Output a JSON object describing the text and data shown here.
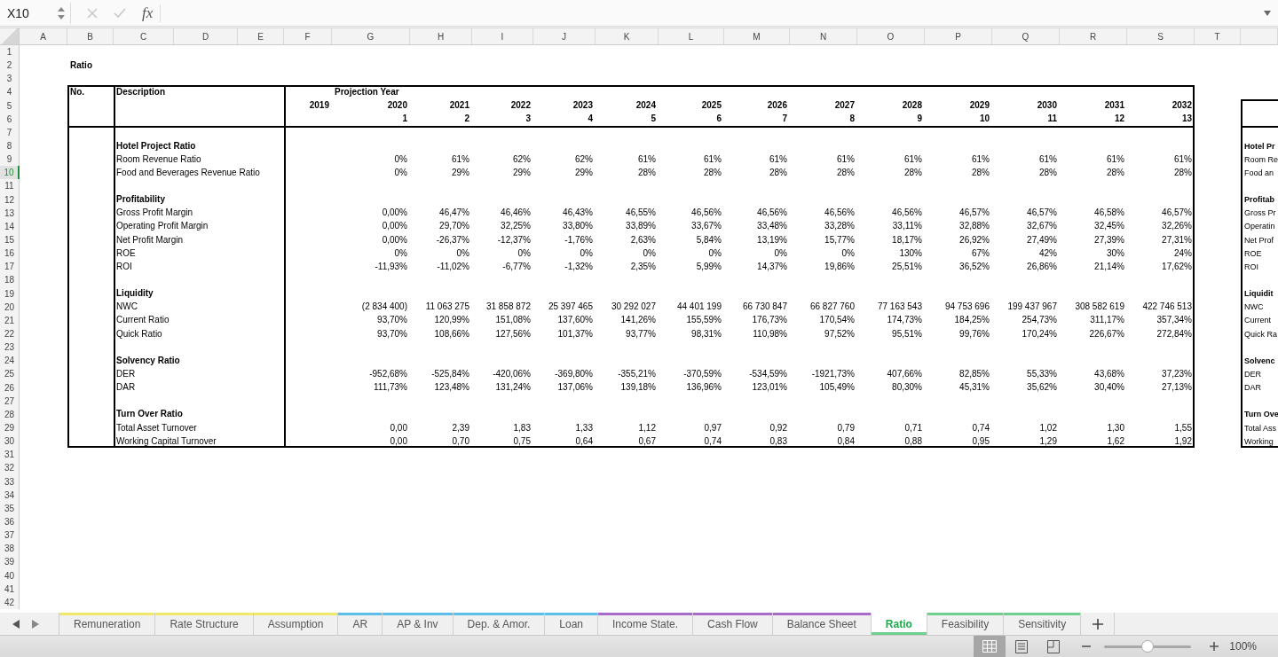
{
  "formula_bar": {
    "name_box": "X10",
    "function_label": "fx"
  },
  "columns": [
    "A",
    "B",
    "C",
    "D",
    "E",
    "F",
    "G",
    "H",
    "I",
    "J",
    "K",
    "L",
    "M",
    "N",
    "O",
    "P",
    "Q",
    "R",
    "S",
    "T"
  ],
  "rows": [
    {
      "label": "1",
      "selected": false
    },
    {
      "label": "2",
      "selected": false
    },
    {
      "label": "3",
      "selected": false
    },
    {
      "label": "4",
      "selected": false
    },
    {
      "label": "5",
      "selected": false
    },
    {
      "label": "6",
      "selected": false
    },
    {
      "label": "7",
      "selected": false
    },
    {
      "label": "8",
      "selected": false
    },
    {
      "label": "9",
      "selected": false
    },
    {
      "label": "10",
      "selected": true
    },
    {
      "label": "11",
      "selected": false
    },
    {
      "label": "12",
      "selected": false
    },
    {
      "label": "13",
      "selected": false
    },
    {
      "label": "14",
      "selected": false
    },
    {
      "label": "15",
      "selected": false
    },
    {
      "label": "16",
      "selected": false
    },
    {
      "label": "17",
      "selected": false
    },
    {
      "label": "18",
      "selected": false
    },
    {
      "label": "19",
      "selected": false
    },
    {
      "label": "20",
      "selected": false
    },
    {
      "label": "21",
      "selected": false
    },
    {
      "label": "22",
      "selected": false
    },
    {
      "label": "23",
      "selected": false
    },
    {
      "label": "24",
      "selected": false
    },
    {
      "label": "25",
      "selected": false
    },
    {
      "label": "26",
      "selected": false
    },
    {
      "label": "27",
      "selected": false
    },
    {
      "label": "28",
      "selected": false
    },
    {
      "label": "29",
      "selected": false
    },
    {
      "label": "30",
      "selected": false
    },
    {
      "label": "31",
      "selected": false
    },
    {
      "label": "32",
      "selected": false
    },
    {
      "label": "33",
      "selected": false
    },
    {
      "label": "34",
      "selected": false
    },
    {
      "label": "35",
      "selected": false
    },
    {
      "label": "36",
      "selected": false
    },
    {
      "label": "37",
      "selected": false
    },
    {
      "label": "38",
      "selected": false
    },
    {
      "label": "39",
      "selected": false
    },
    {
      "label": "40",
      "selected": false
    },
    {
      "label": "41",
      "selected": false
    },
    {
      "label": "42",
      "selected": false
    }
  ],
  "sheet": {
    "title": "Ratio",
    "table": {
      "no_header": "No.",
      "description_header": "Description",
      "projection_label": "Projection Year",
      "years": [
        {
          "year": "2019"
        },
        {
          "year": "2020",
          "index": "1"
        },
        {
          "year": "2021",
          "index": "2"
        },
        {
          "year": "2022",
          "index": "3"
        },
        {
          "year": "2023",
          "index": "4"
        },
        {
          "year": "2024",
          "index": "5"
        },
        {
          "year": "2025",
          "index": "6"
        },
        {
          "year": "2026",
          "index": "7"
        },
        {
          "year": "2027",
          "index": "8"
        },
        {
          "year": "2028",
          "index": "9"
        },
        {
          "year": "2029",
          "index": "10"
        },
        {
          "year": "2030",
          "index": "11"
        },
        {
          "year": "2031",
          "index": "12"
        },
        {
          "year": "2032",
          "index": "13"
        }
      ],
      "sections": [
        {
          "title": "Hotel Project Ratio",
          "rows": [
            {
              "label": "Room Revenue Ratio",
              "values": [
                "0%",
                "61%",
                "62%",
                "62%",
                "61%",
                "61%",
                "61%",
                "61%",
                "61%",
                "61%",
                "61%",
                "61%",
                "61%"
              ]
            },
            {
              "label": "Food and Beverages Revenue Ratio",
              "values": [
                "0%",
                "29%",
                "29%",
                "29%",
                "28%",
                "28%",
                "28%",
                "28%",
                "28%",
                "28%",
                "28%",
                "28%",
                "28%"
              ]
            }
          ]
        },
        {
          "title": "Profitability",
          "rows": [
            {
              "label": "Gross Profit Margin",
              "values": [
                "0,00%",
                "46,47%",
                "46,46%",
                "46,43%",
                "46,55%",
                "46,56%",
                "46,56%",
                "46,56%",
                "46,56%",
                "46,57%",
                "46,57%",
                "46,58%",
                "46,57%"
              ]
            },
            {
              "label": "Operating Profit Margin",
              "values": [
                "0,00%",
                "29,70%",
                "32,25%",
                "33,80%",
                "33,89%",
                "33,67%",
                "33,48%",
                "33,28%",
                "33,11%",
                "32,88%",
                "32,67%",
                "32,45%",
                "32,26%"
              ]
            },
            {
              "label": "Net Profit Margin",
              "values": [
                "0,00%",
                "-26,37%",
                "-12,37%",
                "-1,76%",
                "2,63%",
                "5,84%",
                "13,19%",
                "15,77%",
                "18,17%",
                "26,92%",
                "27,49%",
                "27,39%",
                "27,31%"
              ]
            },
            {
              "label": "ROE",
              "values": [
                "0%",
                "0%",
                "0%",
                "0%",
                "0%",
                "0%",
                "0%",
                "0%",
                "130%",
                "67%",
                "42%",
                "30%",
                "24%"
              ]
            },
            {
              "label": "ROI",
              "values": [
                "-11,93%",
                "-11,02%",
                "-6,77%",
                "-1,32%",
                "2,35%",
                "5,99%",
                "14,37%",
                "19,86%",
                "25,51%",
                "36,52%",
                "26,86%",
                "21,14%",
                "17,62%"
              ]
            }
          ]
        },
        {
          "title": "Liquidity",
          "rows": [
            {
              "label": "NWC",
              "values": [
                "(2 834 400)",
                "11 063 275",
                "31 858 872",
                "25 397 465",
                "30 292 027",
                "44 401 199",
                "66 730 847",
                "66 827 760",
                "77 163 543",
                "94 753 696",
                "199 437 967",
                "308 582 619",
                "422 746 513"
              ]
            },
            {
              "label": "Current Ratio",
              "values": [
                "93,70%",
                "120,99%",
                "151,08%",
                "137,60%",
                "141,26%",
                "155,59%",
                "176,73%",
                "170,54%",
                "174,73%",
                "184,25%",
                "254,73%",
                "311,17%",
                "357,34%"
              ]
            },
            {
              "label": "Quick Ratio",
              "values": [
                "93,70%",
                "108,66%",
                "127,56%",
                "101,37%",
                "93,77%",
                "98,31%",
                "110,98%",
                "97,52%",
                "95,51%",
                "99,76%",
                "170,24%",
                "226,67%",
                "272,84%"
              ]
            }
          ]
        },
        {
          "title": "Solvency Ratio",
          "rows": [
            {
              "label": "DER",
              "values": [
                "-952,68%",
                "-525,84%",
                "-420,06%",
                "-369,80%",
                "-355,21%",
                "-370,59%",
                "-534,59%",
                "-1921,73%",
                "407,66%",
                "82,85%",
                "55,33%",
                "43,68%",
                "37,23%"
              ]
            },
            {
              "label": "DAR",
              "values": [
                "111,73%",
                "123,48%",
                "131,24%",
                "137,06%",
                "139,18%",
                "136,96%",
                "123,01%",
                "105,49%",
                "80,30%",
                "45,31%",
                "35,62%",
                "30,40%",
                "27,13%"
              ]
            }
          ]
        },
        {
          "title": "Turn Over Ratio",
          "rows": [
            {
              "label": "Total Asset Turnover",
              "values": [
                "0,00",
                "2,39",
                "1,83",
                "1,33",
                "1,12",
                "0,97",
                "0,92",
                "0,79",
                "0,71",
                "0,74",
                "1,02",
                "1,30",
                "1,55"
              ]
            },
            {
              "label": "Working Capital Turnover",
              "values": [
                "0,00",
                "0,70",
                "0,75",
                "0,64",
                "0,67",
                "0,74",
                "0,83",
                "0,84",
                "0,88",
                "0,95",
                "1,29",
                "1,62",
                "1,92"
              ]
            }
          ]
        }
      ]
    },
    "side_table": {
      "sections": [
        {
          "title": "Hotel Pr",
          "items": [
            "Room Re",
            "Food an"
          ]
        },
        {
          "title": "Profitab",
          "items": [
            "Gross Pr",
            "Operatin",
            "Net Prof",
            "ROE",
            "ROI"
          ]
        },
        {
          "title": "Liquidit",
          "items": [
            "NWC",
            "Current",
            "Quick Ra"
          ]
        },
        {
          "title": "Solvenc",
          "items": [
            "DER",
            "DAR"
          ]
        },
        {
          "title": "Turn Ove",
          "items": [
            "Total Ass",
            "Working"
          ]
        }
      ]
    }
  },
  "tabs": [
    {
      "label": "Remuneration",
      "color": "#f0e86a",
      "selected": false
    },
    {
      "label": "Rate Structure",
      "color": "#f0e86a",
      "selected": false
    },
    {
      "label": "Assumption",
      "color": "#f0e86a",
      "selected": false
    },
    {
      "label": "AR",
      "color": "#5bbfe8",
      "selected": false
    },
    {
      "label": "AP & Inv",
      "color": "#5bbfe8",
      "selected": false
    },
    {
      "label": "Dep. & Amor.",
      "color": "#5bbfe8",
      "selected": false
    },
    {
      "label": "Loan",
      "color": "#5bbfe8",
      "selected": false
    },
    {
      "label": "Income State.",
      "color": "#a86cc8",
      "selected": false
    },
    {
      "label": "Cash Flow",
      "color": "#a86cc8",
      "selected": false
    },
    {
      "label": "Balance Sheet",
      "color": "#a86cc8",
      "selected": false
    },
    {
      "label": "Ratio",
      "color": "#6fcf8f",
      "selected": true
    },
    {
      "label": "Feasibility",
      "color": "#6fcf8f",
      "selected": false
    },
    {
      "label": "Sensitivity",
      "color": "#6fcf8f",
      "selected": false
    }
  ],
  "status_bar": {
    "views": [
      {
        "kind": "normal",
        "selected": true
      },
      {
        "kind": "page_layout",
        "selected": false
      },
      {
        "kind": "page_break",
        "selected": false
      }
    ],
    "zoom": {
      "level": 0.5,
      "label": "100%"
    }
  }
}
